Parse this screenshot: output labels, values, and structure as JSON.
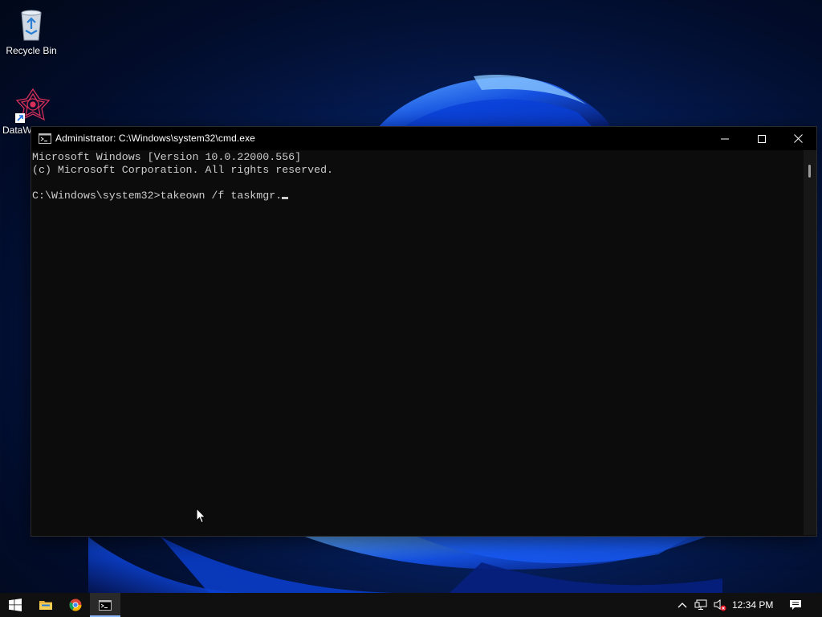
{
  "desktop": {
    "icons": [
      {
        "label": "Recycle Bin",
        "icon": "recycle-bin-icon"
      },
      {
        "label": "DataW",
        "icon": "datawrapper-shortcut-icon"
      }
    ]
  },
  "window": {
    "title": "Administrator: C:\\Windows\\system32\\cmd.exe",
    "icon": "cmd-icon",
    "controls": [
      "minimize-icon",
      "maximize-icon",
      "close-icon"
    ],
    "console": {
      "lines": [
        "Microsoft Windows [Version 10.0.22000.556]",
        "(c) Microsoft Corporation. All rights reserved.",
        "",
        "C:\\Windows\\system32>takeown /f taskmgr."
      ]
    }
  },
  "taskbar": {
    "buttons": [
      {
        "name": "start",
        "icon": "windows-logo-icon"
      },
      {
        "name": "file-explorer",
        "icon": "folder-icon"
      },
      {
        "name": "chrome",
        "icon": "chrome-icon"
      },
      {
        "name": "command-prompt",
        "icon": "cmd-icon",
        "active": true
      }
    ],
    "tray": {
      "icons": [
        "chevron-up-icon",
        "network-icon",
        "volume-muted-icon",
        "notifications-icon"
      ],
      "clock": "12:34 PM"
    }
  },
  "colors": {
    "console_bg": "#0c0c0c",
    "console_fg": "#cccccc",
    "titlebar_bg": "#000000",
    "taskbar_bg": "#101010"
  }
}
